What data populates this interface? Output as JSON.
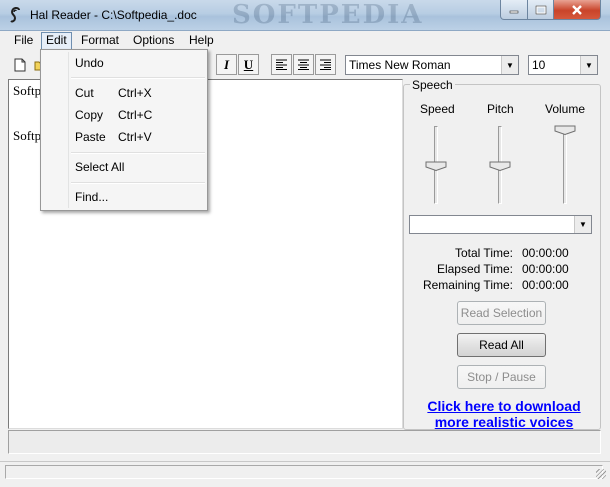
{
  "window": {
    "title": "Hal Reader - C:\\Softpedia_.doc",
    "watermark": "SOFTPEDIA"
  },
  "menubar": {
    "items": [
      {
        "label": "File",
        "key": "file"
      },
      {
        "label": "Edit",
        "key": "edit",
        "active": true
      },
      {
        "label": "Format",
        "key": "format"
      },
      {
        "label": "Options",
        "key": "options"
      },
      {
        "label": "Help",
        "key": "help"
      }
    ]
  },
  "edit_menu": {
    "undo": "Undo",
    "cut": "Cut",
    "cut_shortcut": "Ctrl+X",
    "copy": "Copy",
    "copy_shortcut": "Ctrl+C",
    "paste": "Paste",
    "paste_shortcut": "Ctrl+V",
    "select_all": "Select All",
    "find": "Find..."
  },
  "toolbar": {
    "italic": "I",
    "underline": "U",
    "font_name": "Times New Roman",
    "font_size": "10"
  },
  "document": {
    "lines": [
      "Softp",
      "Softp"
    ]
  },
  "speech": {
    "group_label": "Speech",
    "speed_label": "Speed",
    "pitch_label": "Pitch",
    "volume_label": "Volume",
    "voice": "",
    "total_time_label": "Total Time:",
    "total_time": "00:00:00",
    "elapsed_time_label": "Elapsed Time:",
    "elapsed_time": "00:00:00",
    "remaining_time_label": "Remaining Time:",
    "remaining_time": "00:00:00",
    "read_selection": "Read Selection",
    "read_all": "Read All",
    "stop_pause": "Stop / Pause",
    "download_line1": "Click here to download",
    "download_line2": "more realistic voices"
  },
  "colors": {
    "link": "#0000ff",
    "title_bar": "#b7cde3",
    "close_button": "#c9442a"
  }
}
